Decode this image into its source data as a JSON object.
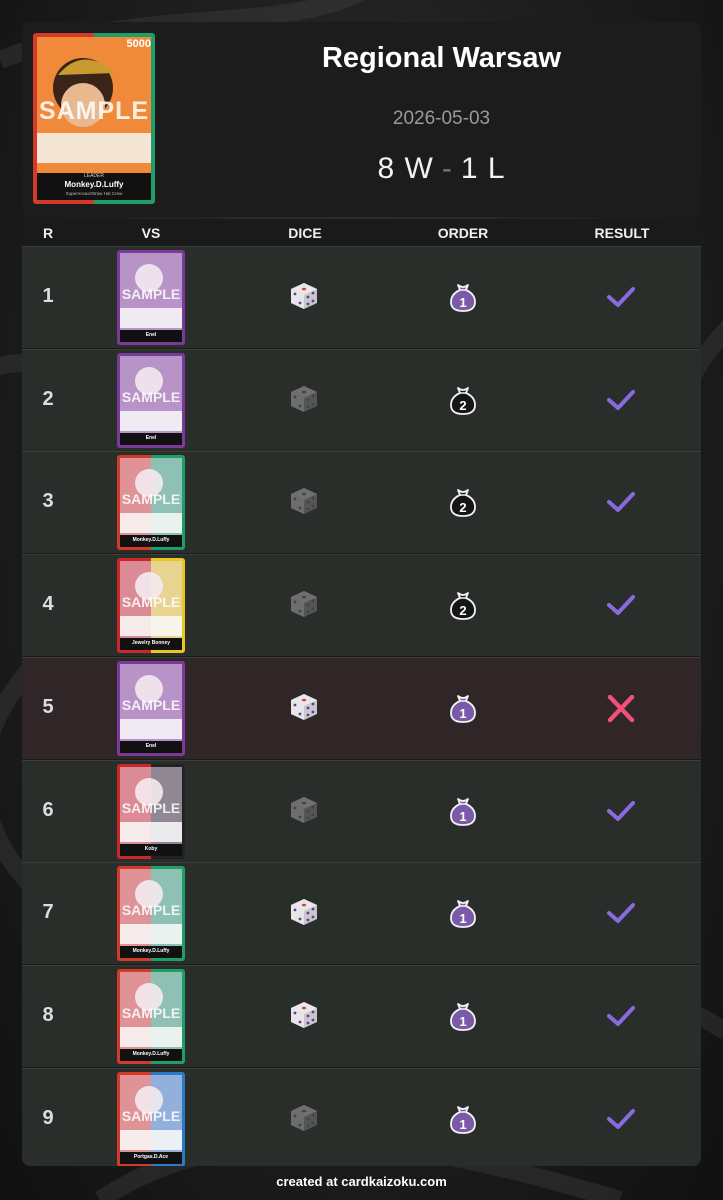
{
  "event": {
    "title": "Regional Warsaw",
    "date": "2026-05-03",
    "wins": "8 W",
    "separator": "-",
    "losses": "1 L",
    "leader": {
      "name": "Monkey.D.Luffy",
      "subtitle": "Supernovas/Straw Hat Crew",
      "type_label": "LEADER",
      "power": "5000",
      "watermark": "SAMPLE",
      "color_a": "#d23a2a",
      "color_b": "#1f9e6a"
    }
  },
  "table": {
    "headers": {
      "round": "R",
      "vs": "VS",
      "dice": "DICE",
      "order": "ORDER",
      "result": "RESULT"
    },
    "rows": [
      {
        "round": "1",
        "opponent": "Enel",
        "card_colors": [
          "#7a3a9a",
          "#7a3a9a"
        ],
        "dice": "won",
        "order": "1",
        "result": "win"
      },
      {
        "round": "2",
        "opponent": "Enel",
        "card_colors": [
          "#7a3a9a",
          "#7a3a9a"
        ],
        "dice": "lost",
        "order": "2",
        "result": "win"
      },
      {
        "round": "3",
        "opponent": "Monkey.D.Luffy",
        "card_colors": [
          "#d23a2a",
          "#1f9e6a"
        ],
        "dice": "lost",
        "order": "2",
        "result": "win"
      },
      {
        "round": "4",
        "opponent": "Jewelry Bonney",
        "card_colors": [
          "#c8282a",
          "#e6c821"
        ],
        "dice": "lost",
        "order": "2",
        "result": "win"
      },
      {
        "round": "5",
        "opponent": "Enel",
        "card_colors": [
          "#7a3a9a",
          "#7a3a9a"
        ],
        "dice": "won",
        "order": "1",
        "result": "loss"
      },
      {
        "round": "6",
        "opponent": "Koby",
        "card_colors": [
          "#c8282a",
          "#222222"
        ],
        "dice": "lost",
        "order": "1",
        "result": "win"
      },
      {
        "round": "7",
        "opponent": "Monkey.D.Luffy",
        "card_colors": [
          "#d23a2a",
          "#1f9e6a"
        ],
        "dice": "won",
        "order": "1",
        "result": "win"
      },
      {
        "round": "8",
        "opponent": "Monkey.D.Luffy",
        "card_colors": [
          "#d23a2a",
          "#1f9e6a"
        ],
        "dice": "won",
        "order": "1",
        "result": "win"
      },
      {
        "round": "9",
        "opponent": "Portgas.D.Ace",
        "card_colors": [
          "#d23a2a",
          "#2a7ac8"
        ],
        "dice": "lost",
        "order": "1",
        "result": "win"
      }
    ]
  },
  "colors": {
    "accent": "#8a6ae0",
    "loss": "#f0507a",
    "dice_won": "#e8e8ea",
    "dice_lost": "#707070",
    "order_first_fill": "#7a5aa8"
  },
  "footer": "created at cardkaizoku.com"
}
